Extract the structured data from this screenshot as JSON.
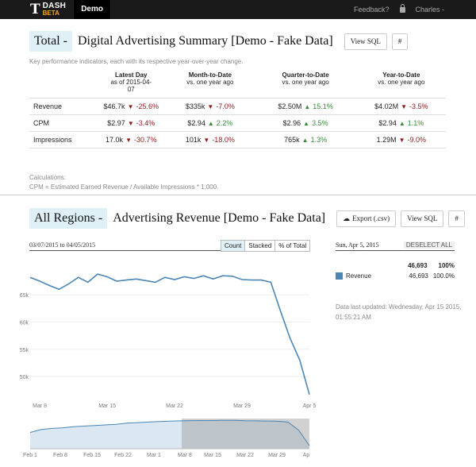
{
  "navbar": {
    "logo_t": "T",
    "logo_dash": "DASH",
    "logo_beta": "BETA",
    "demo_tab": "Demo",
    "feedback": "Feedback?",
    "user": "Charles -"
  },
  "summary": {
    "selector": "Total -",
    "title": "Digital Advertising Summary [Demo - Fake Data]",
    "view_sql": "View SQL",
    "hash": "#",
    "subtitle": "Key performance indicators, each with its respective year-over-year change.",
    "columns": [
      {
        "title": "Latest Day",
        "sub": "as of 2015-04-07"
      },
      {
        "title": "Month-to-Date",
        "sub": "vs. one year ago"
      },
      {
        "title": "Quarter-to-Date",
        "sub": "vs. one year ago"
      },
      {
        "title": "Year-to-Date",
        "sub": "vs. one year ago"
      }
    ],
    "rows": [
      {
        "metric": "Revenue",
        "cells": [
          {
            "value": "$46.7k",
            "dir": "down",
            "change": "-25.6%"
          },
          {
            "value": "$335k",
            "dir": "down",
            "change": "-7.0%"
          },
          {
            "value": "$2.50M",
            "dir": "up",
            "change": "15.1%"
          },
          {
            "value": "$4.02M",
            "dir": "down",
            "change": "-3.5%"
          }
        ]
      },
      {
        "metric": "CPM",
        "cells": [
          {
            "value": "$2.97",
            "dir": "down",
            "change": "-3.4%"
          },
          {
            "value": "$2.94",
            "dir": "up",
            "change": "2.2%"
          },
          {
            "value": "$2.96",
            "dir": "up",
            "change": "3.5%"
          },
          {
            "value": "$2.94",
            "dir": "up",
            "change": "1.1%"
          }
        ]
      },
      {
        "metric": "Impressions",
        "cells": [
          {
            "value": "17.0k",
            "dir": "down",
            "change": "-30.7%"
          },
          {
            "value": "101k",
            "dir": "down",
            "change": "-18.0%"
          },
          {
            "value": "765k",
            "dir": "up",
            "change": "1.3%"
          },
          {
            "value": "1.29M",
            "dir": "down",
            "change": "-9.0%"
          }
        ]
      }
    ],
    "calc_label": "Calculations:",
    "calc_formula": "CPM = Estimated Earned Revenue / Available Impressions * 1,000."
  },
  "region": {
    "selector": "All Regions -",
    "title": "Advertising Revenue [Demo - Fake Data]",
    "export": "Export (.csv)",
    "view_sql": "View SQL",
    "hash": "#",
    "date_range": "03/07/2015 to 04/05/2015",
    "toggle": [
      "Count",
      "Stacked",
      "% of Total"
    ],
    "legend_date": "Sun, Apr 5, 2015",
    "deselect": "DESELECT ALL",
    "total_value": "46,693",
    "total_pct": "100%",
    "series_name": "Revenue",
    "series_value": "46,693",
    "series_pct": "100.0%",
    "updated": "Data last updated: Wednesday, Apr 15 2015, 01:55:21 AM"
  },
  "chart_data": {
    "type": "line",
    "series": [
      {
        "name": "Revenue",
        "color": "#4b86b4",
        "x": [
          "2015-03-07",
          "2015-03-08",
          "2015-03-09",
          "2015-03-10",
          "2015-03-11",
          "2015-03-12",
          "2015-03-13",
          "2015-03-14",
          "2015-03-15",
          "2015-03-16",
          "2015-03-17",
          "2015-03-18",
          "2015-03-19",
          "2015-03-20",
          "2015-03-21",
          "2015-03-22",
          "2015-03-23",
          "2015-03-24",
          "2015-03-25",
          "2015-03-26",
          "2015-03-27",
          "2015-03-28",
          "2015-03-29",
          "2015-03-30",
          "2015-03-31",
          "2015-04-01",
          "2015-04-02",
          "2015-04-03",
          "2015-04-04",
          "2015-04-05"
        ],
        "values": [
          68200,
          67500,
          66700,
          66000,
          67000,
          68200,
          67300,
          68800,
          68300,
          67500,
          67700,
          67900,
          67600,
          67300,
          68200,
          67800,
          68300,
          68000,
          68500,
          67900,
          68500,
          68400,
          67800,
          67700,
          67700,
          67300,
          62000,
          57000,
          53000,
          46693
        ]
      }
    ],
    "y_ticks": [
      "65k",
      "60k",
      "55k",
      "50k"
    ],
    "y_tick_values": [
      65000,
      60000,
      55000,
      50000
    ],
    "ylim": [
      45500,
      71000
    ],
    "x_ticks": [
      "Mar 8",
      "Mar 15",
      "Mar 22",
      "Mar 29",
      "Apr 5"
    ],
    "context_ticks": [
      "Feb 1",
      "Feb 8",
      "Feb 15",
      "Feb 22",
      "Mar 1",
      "Mar 8",
      "Mar 15",
      "Mar 22",
      "Mar 29",
      "Ap"
    ],
    "context_values": [
      58000,
      60500,
      61500,
      62000,
      63000,
      63500,
      64000,
      64500,
      65000,
      66000,
      66500,
      67000,
      67500,
      67800,
      68000,
      68200,
      68300,
      68300,
      68400,
      68400,
      68100,
      68000,
      67900,
      67700,
      67000,
      60000,
      46693
    ],
    "grid": true,
    "legend": "right"
  }
}
